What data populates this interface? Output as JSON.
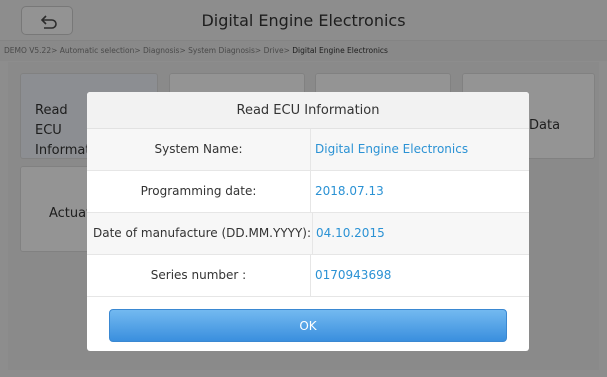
{
  "header": {
    "title": "Digital Engine Electronics",
    "back_icon": "back-arrow-icon"
  },
  "breadcrumb": {
    "path": "DEMO V5.22> Automatic selection> Diagnosis> System Diagnosis> Drive> ",
    "current": "Digital Engine Electronics"
  },
  "tiles": [
    {
      "label": "Read ECU Information"
    },
    {
      "label": ""
    },
    {
      "label": ""
    },
    {
      "label": "Data"
    },
    {
      "label": "Actuation"
    }
  ],
  "dialog": {
    "title": "Read ECU Information",
    "rows": [
      {
        "label": "System Name:",
        "value": "Digital Engine Electronics"
      },
      {
        "label": "Programming date:",
        "value": "2018.07.13"
      },
      {
        "label": "Date of manufacture (DD.MM.YYYY):",
        "value": "04.10.2015"
      },
      {
        "label": "Series number :",
        "value": "0170943698"
      }
    ],
    "ok_label": "OK"
  },
  "colors": {
    "accent": "#3a8fde",
    "value_text": "#2b92d4"
  }
}
